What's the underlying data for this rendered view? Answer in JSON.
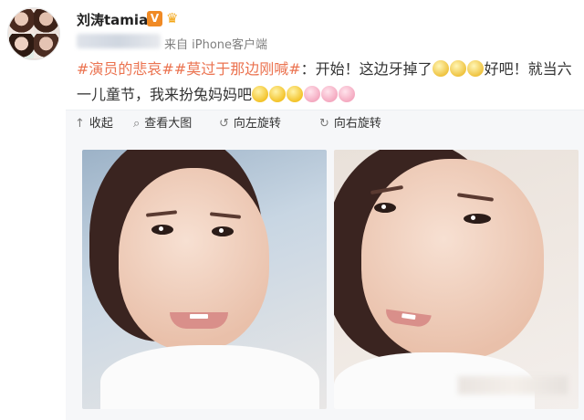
{
  "post": {
    "username": "刘涛tamia",
    "vip_badge": "V",
    "source": "来自 iPhone客户端",
    "text": {
      "tag1": "#演员的悲哀#",
      "tag2": "#莫过于那边刚喊#",
      "part1": "：开始！这边牙掉了",
      "part2": "好吧！就当六一儿童节，我来扮兔妈妈吧"
    }
  },
  "toolbar": {
    "collapse": "收起",
    "view_large": "查看大图",
    "rotate_left": "向左旋转",
    "rotate_right": "向右旋转"
  },
  "icons": {
    "collapse": "arrow-up-icon",
    "view_large": "magnify-icon",
    "rotate_left": "rotate-left-icon",
    "rotate_right": "rotate-right-icon"
  },
  "colors": {
    "tag": "#eb7350",
    "vip": "#f08a25",
    "toolbar_bg": "#f6f7f9"
  }
}
